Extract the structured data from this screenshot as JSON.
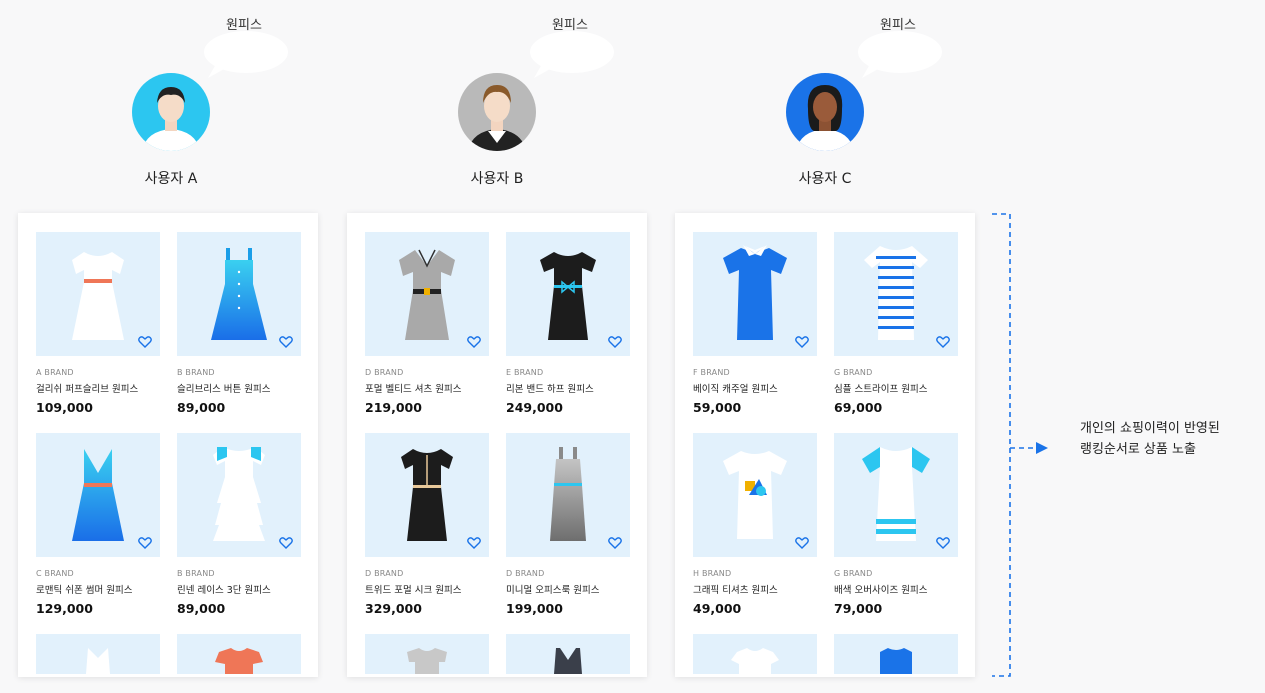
{
  "users": [
    {
      "name": "사용자 A",
      "bubble": "원피스"
    },
    {
      "name": "사용자 B",
      "bubble": "원피스"
    },
    {
      "name": "사용자 C",
      "bubble": "원피스"
    }
  ],
  "panels": [
    {
      "products": [
        {
          "brand": "A BRAND",
          "title": "걸리쉬 퍼프슬리브 원피스",
          "price": "109,000"
        },
        {
          "brand": "B BRAND",
          "title": "슬리브리스 버튼 원피스",
          "price": "89,000"
        },
        {
          "brand": "C BRAND",
          "title": "로맨틱 쉬폰 썸머 원피스",
          "price": "129,000"
        },
        {
          "brand": "B BRAND",
          "title": "린넨 레이스 3단 원피스",
          "price": "89,000"
        }
      ]
    },
    {
      "products": [
        {
          "brand": "D BRAND",
          "title": "포멀 벨티드 셔츠 원피스",
          "price": "219,000"
        },
        {
          "brand": "E BRAND",
          "title": "리본 밴드 하프 원피스",
          "price": "249,000"
        },
        {
          "brand": "D BRAND",
          "title": "트위드 포멀 시크 원피스",
          "price": "329,000"
        },
        {
          "brand": "D BRAND",
          "title": "미니멀 오피스룩 원피스",
          "price": "199,000"
        }
      ]
    },
    {
      "products": [
        {
          "brand": "F BRAND",
          "title": "베이직 캐주얼 원피스",
          "price": "59,000"
        },
        {
          "brand": "G BRAND",
          "title": "심플 스트라이프 원피스",
          "price": "69,000"
        },
        {
          "brand": "H BRAND",
          "title": "그래픽 티셔츠 원피스",
          "price": "49,000"
        },
        {
          "brand": "G BRAND",
          "title": "배색 오버사이즈 원피스",
          "price": "79,000"
        }
      ]
    }
  ],
  "note": {
    "line1": "개인의 쇼핑이력이 반영된",
    "line2": "랭킹순서로 상품 노출"
  },
  "colors": {
    "accent": "#1a73e8",
    "thumb_bg": "#e2f1fc"
  }
}
